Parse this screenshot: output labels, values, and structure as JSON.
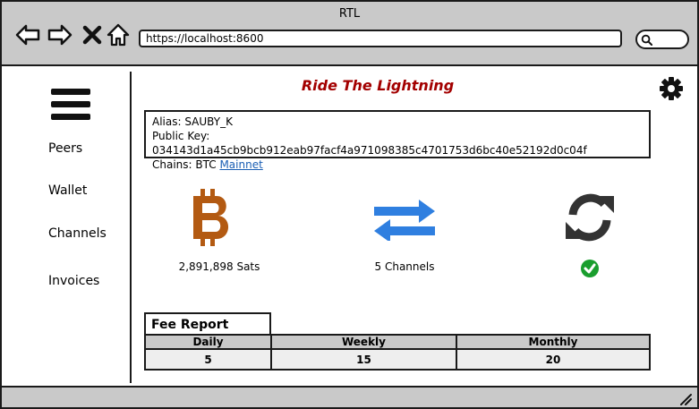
{
  "window": {
    "title": "RTL"
  },
  "toolbar": {
    "url": "https://localhost:8600",
    "icons": [
      "back-arrow-icon",
      "forward-arrow-icon",
      "close-icon",
      "home-icon",
      "search-icon"
    ]
  },
  "sidebar": {
    "menu_icon": "hamburger-menu-icon",
    "items": [
      {
        "label": "Peers"
      },
      {
        "label": "Wallet"
      },
      {
        "label": "Channels"
      },
      {
        "label": "Invoices"
      }
    ]
  },
  "header": {
    "title": "Ride The Lightning",
    "title_color": "#a30000",
    "settings_icon": "gear-icon"
  },
  "node_info": {
    "alias": "Alias: SAUBY_K",
    "public_key": "Public Key: 034143d1a45cb9bcb912eab97facf4a971098385c4701753d6bc40e52192d0c04f",
    "chains_prefix": "Chains: BTC ",
    "chain_link": "Mainnet"
  },
  "stats": {
    "balance": {
      "icon": "bitcoin-icon",
      "label": "2,891,898 Sats",
      "color": "#b35a12"
    },
    "channels": {
      "icon": "transfer-arrows-icon",
      "label": "5 Channels",
      "color": "#2f7fe0"
    },
    "sync": {
      "icon": "refresh-icon",
      "status_icon": "check-circle-icon",
      "status_color": "#1a9e2e"
    }
  },
  "fee_report": {
    "title": "Fee Report",
    "headers": [
      "Daily",
      "Weekly",
      "Monthly"
    ],
    "values": [
      "5",
      "15",
      "20"
    ]
  }
}
